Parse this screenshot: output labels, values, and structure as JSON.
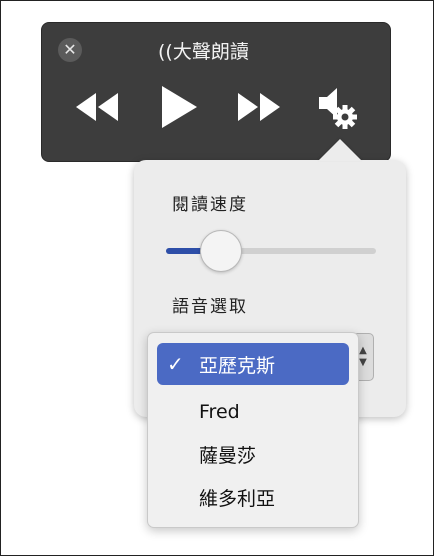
{
  "toolbar": {
    "title": "((大聲朗讀",
    "close_icon": "close-icon",
    "controls": [
      "rewind-icon",
      "play-icon",
      "fast-forward-icon",
      "speaker-settings-icon"
    ]
  },
  "popover": {
    "speed_label": "閱讀速度",
    "speed_level_percent": 24,
    "voice_label": "語音選取"
  },
  "voice_menu": {
    "selected_check": "✓",
    "items": [
      {
        "label": "亞歷克斯",
        "selected": true
      },
      {
        "label": "Fred",
        "selected": false
      },
      {
        "label": "薩曼莎",
        "selected": false
      },
      {
        "label": "維多利亞",
        "selected": false
      }
    ]
  },
  "colors": {
    "toolbar_bg": "#3d3d3d",
    "popover_bg": "#ececec",
    "accent": "#4b6ac4",
    "slider_fill": "#2d4ea8"
  }
}
